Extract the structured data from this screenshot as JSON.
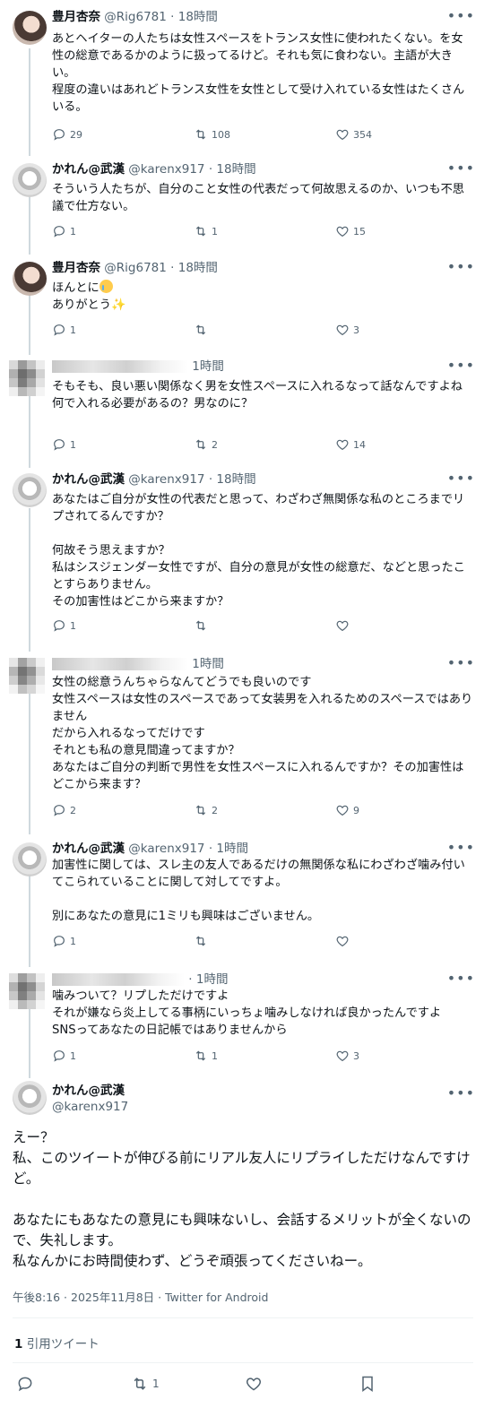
{
  "tweets": [
    {
      "name": "豊月杏奈",
      "handle": "@Rig6781",
      "time": "18時間",
      "text": "あとヘイターの人たちは女性スペースをトランス女性に使われたくない。を女性の総意であるかのように扱ってるけど。それも気に食わない。主語が大きい。\n程度の違いはあれどトランス女性を女性として受け入れている女性はたくさんいる。",
      "replies": "29",
      "retweets": "108",
      "likes": "354"
    },
    {
      "name": "かれん@武漢",
      "handle": "@karenx917",
      "time": "18時間",
      "text": "そういう人たちが、自分のこと女性の代表だって何故思えるのか、いつも不思議で仕方ない。",
      "replies": "1",
      "retweets": "1",
      "likes": "15"
    },
    {
      "name": "豊月杏奈",
      "handle": "@Rig6781",
      "time": "18時間",
      "text1": "ほんとに",
      "text2": "ありがとう",
      "replies": "1",
      "retweets": "",
      "likes": "3"
    },
    {
      "time": "1時間",
      "text": "そもそも、良い悪い関係なく男を女性スペースに入れるなって話なんですよね\n何で入れる必要があるの？男なのに？",
      "replies": "1",
      "retweets": "2",
      "likes": "14"
    },
    {
      "name": "かれん@武漢",
      "handle": "@karenx917",
      "time": "18時間",
      "text": "あなたはご自分が女性の代表だと思って、わざわざ無関係な私のところまでリプされてるんですか？\n\n何故そう思えますか？\n私はシスジェンダー女性ですが、自分の意見が女性の総意だ、などと思ったことすらありません。\nその加害性はどこから来ますか？",
      "replies": "1",
      "retweets": "",
      "likes": ""
    },
    {
      "time": "1時間",
      "text": "女性の総意うんちゃらなんてどうでも良いのです\n女性スペースは女性のスペースであって女装男を入れるためのスペースではありません\nだから入れるなってだけです\nそれとも私の意見間違ってますか？\nあなたはご自分の判断で男性を女性スペースに入れるんですか？その加害性はどこから来ます？",
      "replies": "2",
      "retweets": "2",
      "likes": "9"
    },
    {
      "name": "かれん@武漢",
      "handle": "@karenx917",
      "time": "1時間",
      "text": "加害性に関しては、スレ主の友人であるだけの無関係な私にわざわざ噛み付いてこられていることに関して対してですよ。\n\n別にあなたの意見に1ミリも興味はございません。",
      "replies": "1",
      "retweets": "",
      "likes": ""
    },
    {
      "time": "1時間",
      "text": "噛みついて？リプしただけですよ\nそれが嫌なら炎上してる事柄にいっちょ噛みしなければ良かったんですよ\nSNSってあなたの日記帳ではありませんから",
      "replies": "1",
      "retweets": "1",
      "likes": "3"
    }
  ],
  "main": {
    "name": "かれん@武漢",
    "handle": "@karenx917",
    "text": "えー？\n私、このツイートが伸びる前にリアル友人にリプライしただけなんですけど。\n\nあなたにもあなたの意見にも興味ないし、会話するメリットが全くないので、失礼します。\n私なんかにお時間使わず、どうぞ頑張ってくださいねー。",
    "timestamp": "午後8:16 · 2025年11月8日 · Twitter for Android",
    "quote_count": "1",
    "quote_label": "引用ツイート",
    "retweets": "1"
  },
  "colors": {
    "text": "#0f1419",
    "secondary": "#536471",
    "divider": "#eff3f4",
    "thread": "#cfd9de"
  }
}
